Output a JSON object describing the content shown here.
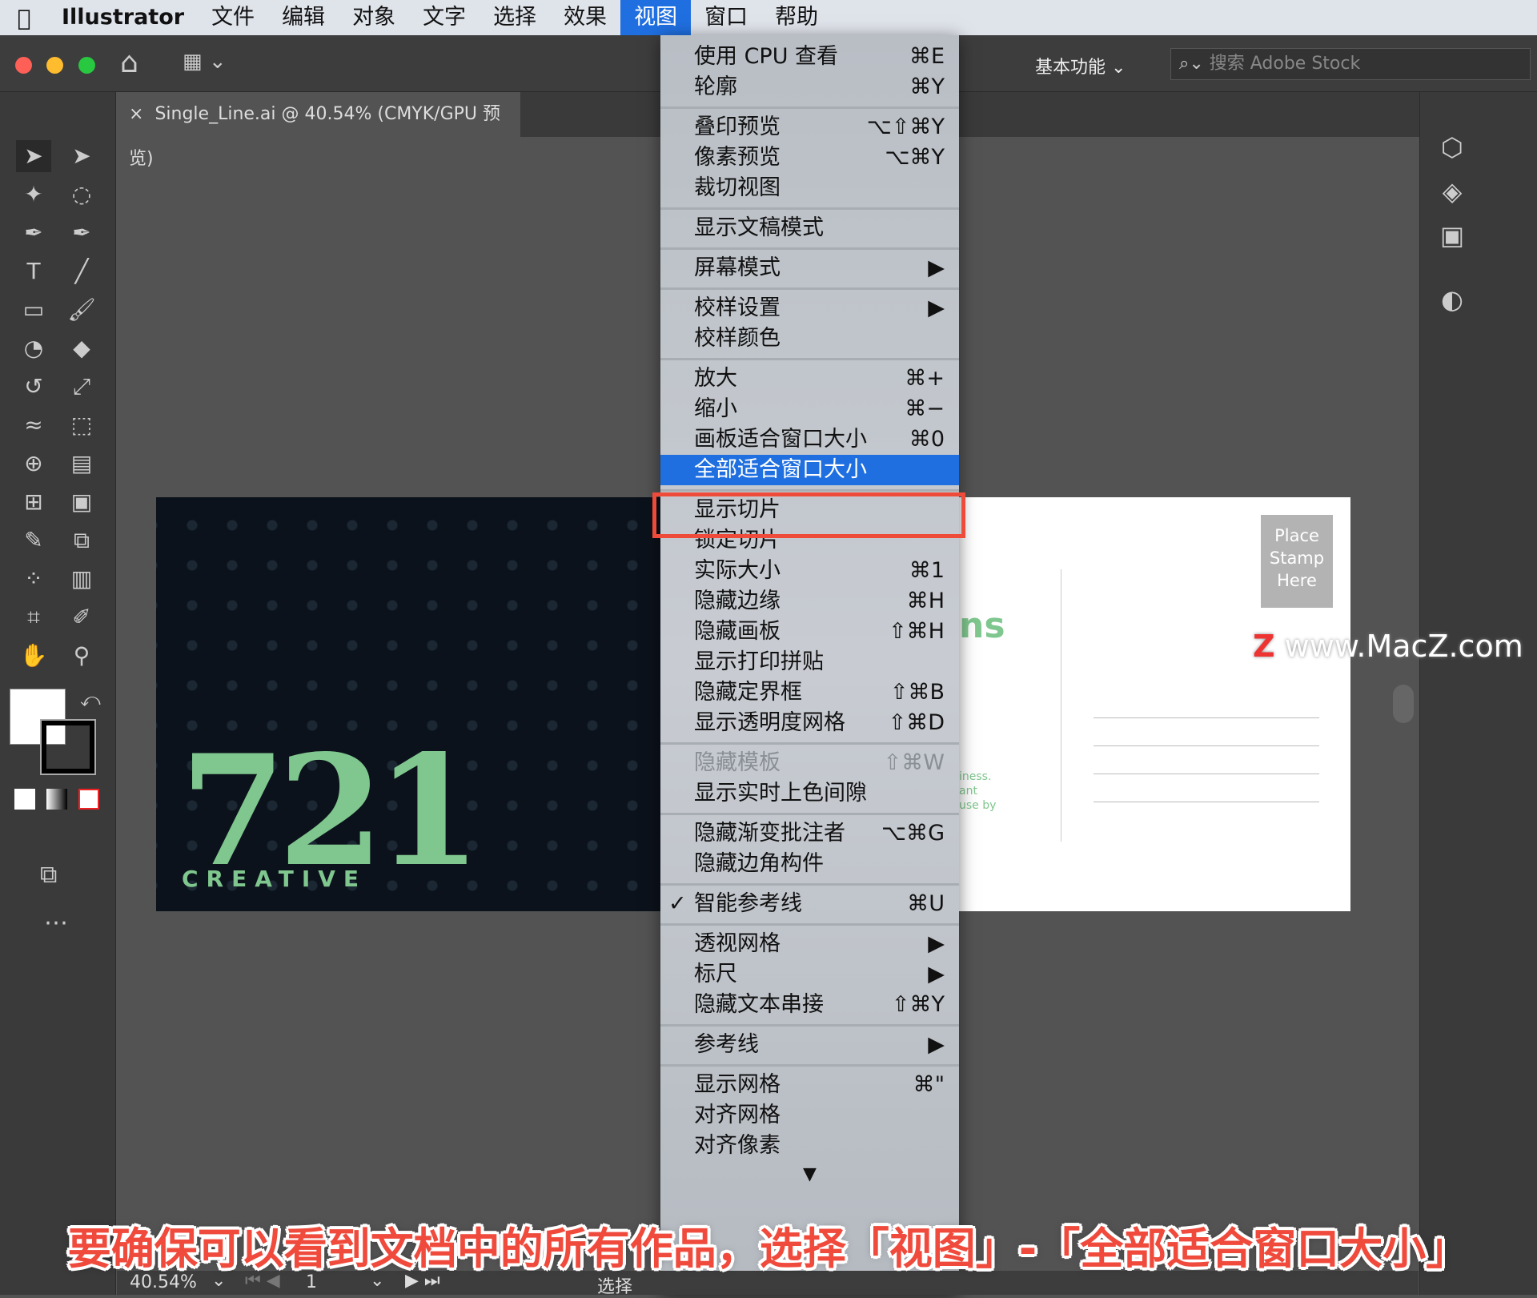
{
  "menubar": {
    "apple": "",
    "app": "Illustrator",
    "items": [
      "文件",
      "编辑",
      "对象",
      "文字",
      "选择",
      "效果",
      "视图",
      "窗口",
      "帮助"
    ],
    "active": "视图"
  },
  "topbar": {
    "workspace": "基本功能",
    "search_placeholder": "搜索 Adobe Stock"
  },
  "tab": {
    "title": "Single_Line.ai @ 40.54% (CMYK/GPU 预览)",
    "close": "×"
  },
  "artboard_dark": {
    "number": "721",
    "word": "CREATIVE"
  },
  "artboard_white": {
    "stamp": "Place Stamp Here",
    "partial_heading": "ns",
    "partial_text": [
      "iness.",
      "ant",
      "use by"
    ]
  },
  "menu": {
    "groups": [
      [
        {
          "label": "使用 CPU 查看",
          "shortcut": "⌘E"
        },
        {
          "label": "轮廓",
          "shortcut": "⌘Y"
        }
      ],
      [
        {
          "label": "叠印预览",
          "shortcut": "⌥⇧⌘Y"
        },
        {
          "label": "像素预览",
          "shortcut": "⌥⌘Y"
        },
        {
          "label": "裁切视图",
          "shortcut": ""
        }
      ],
      [
        {
          "label": "显示文稿模式",
          "shortcut": ""
        }
      ],
      [
        {
          "label": "屏幕模式",
          "shortcut": "▶"
        }
      ],
      [
        {
          "label": "校样设置",
          "shortcut": "▶"
        },
        {
          "label": "校样颜色",
          "shortcut": ""
        }
      ],
      [
        {
          "label": "放大",
          "shortcut": "⌘+"
        },
        {
          "label": "缩小",
          "shortcut": "⌘−"
        },
        {
          "label": "画板适合窗口大小",
          "shortcut": "⌘0"
        },
        {
          "label": "全部适合窗口大小",
          "shortcut": "",
          "highlighted": true
        }
      ],
      [
        {
          "label": "显示切片",
          "shortcut": ""
        },
        {
          "label": "锁定切片",
          "shortcut": ""
        },
        {
          "label": "实际大小",
          "shortcut": "⌘1"
        },
        {
          "label": "隐藏边缘",
          "shortcut": "⌘H"
        },
        {
          "label": "隐藏画板",
          "shortcut": "⇧⌘H"
        },
        {
          "label": "显示打印拼贴",
          "shortcut": ""
        },
        {
          "label": "隐藏定界框",
          "shortcut": "⇧⌘B"
        },
        {
          "label": "显示透明度网格",
          "shortcut": "⇧⌘D"
        }
      ],
      [
        {
          "label": "隐藏模板",
          "shortcut": "⇧⌘W",
          "disabled": true
        },
        {
          "label": "显示实时上色间隙",
          "shortcut": ""
        }
      ],
      [
        {
          "label": "隐藏渐变批注者",
          "shortcut": "⌥⌘G"
        },
        {
          "label": "隐藏边角构件",
          "shortcut": ""
        }
      ],
      [
        {
          "label": "智能参考线",
          "shortcut": "⌘U",
          "checked": true
        }
      ],
      [
        {
          "label": "透视网格",
          "shortcut": "▶"
        },
        {
          "label": "标尺",
          "shortcut": "▶"
        },
        {
          "label": "隐藏文本串接",
          "shortcut": "⇧⌘Y"
        }
      ],
      [
        {
          "label": "参考线",
          "shortcut": "▶"
        }
      ],
      [
        {
          "label": "显示网格",
          "shortcut": "⌘\""
        },
        {
          "label": "对齐网格",
          "shortcut": ""
        },
        {
          "label": "对齐像素",
          "shortcut": ""
        }
      ]
    ],
    "scroll_arrow": "▼"
  },
  "status": {
    "zoom": "40.54%",
    "page": "1",
    "tool": "选择"
  },
  "caption": "要确保可以看到文档中的所有作品，选择「视图」-「全部适合窗口大小」",
  "watermark": "www.MacZ.com",
  "colors": {
    "accent": "#1f6fe0",
    "highlight_border": "#ee4b3a",
    "brand_green": "#7fc78e"
  }
}
